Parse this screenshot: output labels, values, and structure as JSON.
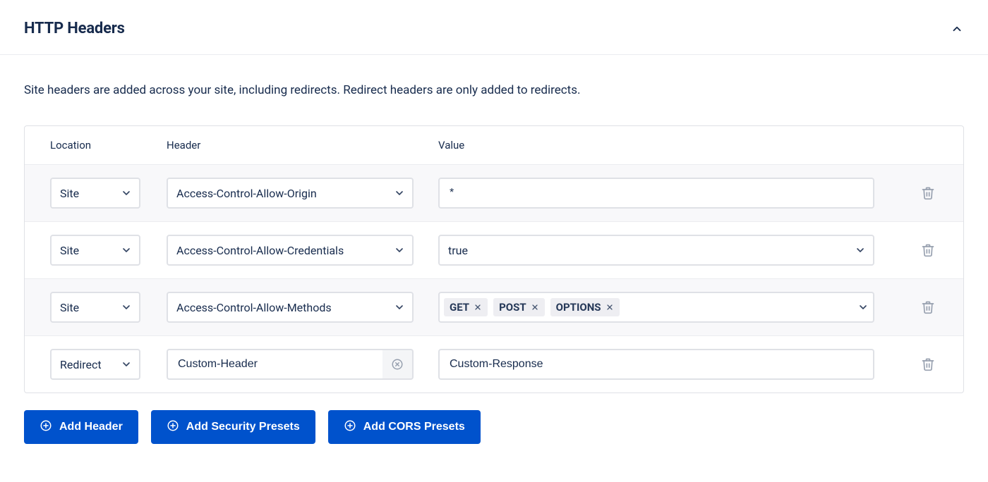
{
  "section": {
    "title": "HTTP Headers",
    "description": "Site headers are added across your site, including redirects. Redirect headers are only added to redirects."
  },
  "columns": {
    "location": "Location",
    "header": "Header",
    "value": "Value"
  },
  "rows": [
    {
      "location": "Site",
      "header": "Access-Control-Allow-Origin",
      "value_type": "text",
      "value": "*"
    },
    {
      "location": "Site",
      "header": "Access-Control-Allow-Credentials",
      "value_type": "select",
      "value": "true"
    },
    {
      "location": "Site",
      "header": "Access-Control-Allow-Methods",
      "value_type": "tags",
      "tags": [
        "GET",
        "POST",
        "OPTIONS"
      ]
    },
    {
      "location": "Redirect",
      "header": "Custom-Header",
      "header_editable": true,
      "value_type": "text",
      "value": "Custom-Response"
    }
  ],
  "buttons": {
    "add_header": "Add Header",
    "add_security": "Add Security Presets",
    "add_cors": "Add CORS Presets"
  }
}
